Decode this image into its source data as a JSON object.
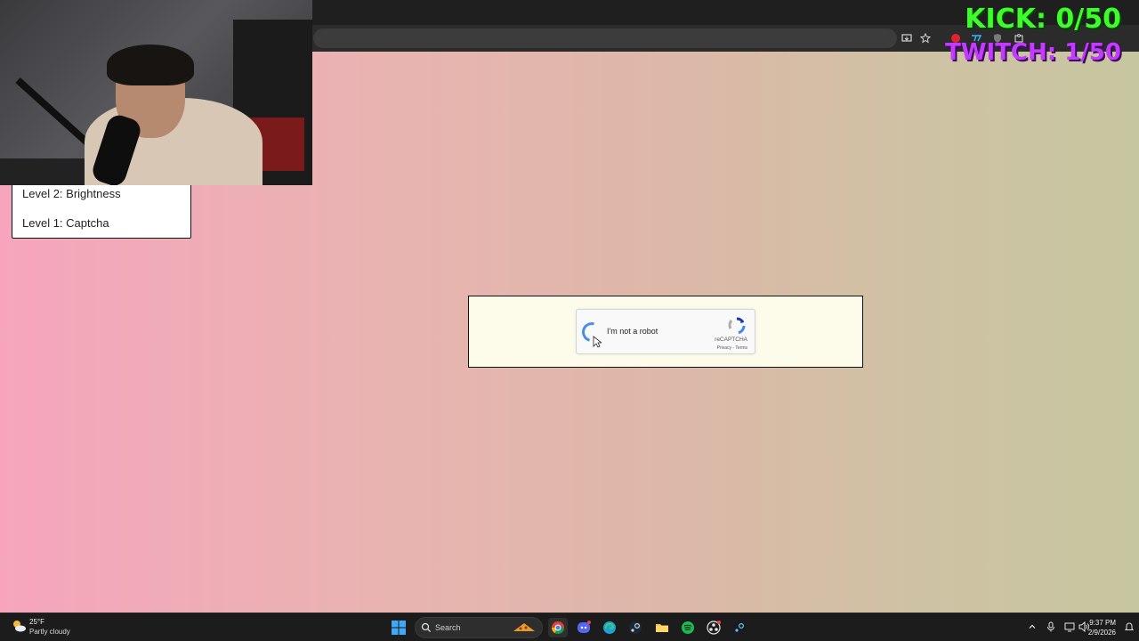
{
  "levels": {
    "items": [
      {
        "label": "Level 2: Brightness"
      },
      {
        "label": "Level 1: Captcha"
      }
    ]
  },
  "captcha": {
    "checkbox_label": "I'm not a robot",
    "brand": "reCAPTCHA",
    "terms": "Privacy - Terms"
  },
  "stream": {
    "kick": "KICK: 0/50",
    "twitch": "TWITCH: 1/50"
  },
  "taskbar": {
    "weather_temp": "25°F",
    "weather_desc": "Partly cloudy",
    "search_label": "Search",
    "time": "9:37 PM",
    "date": "2/9/2026"
  },
  "colors": {
    "kick": "#3cff2a",
    "twitch": "#c43bff",
    "recaptcha_blue": "#4a90e2"
  }
}
